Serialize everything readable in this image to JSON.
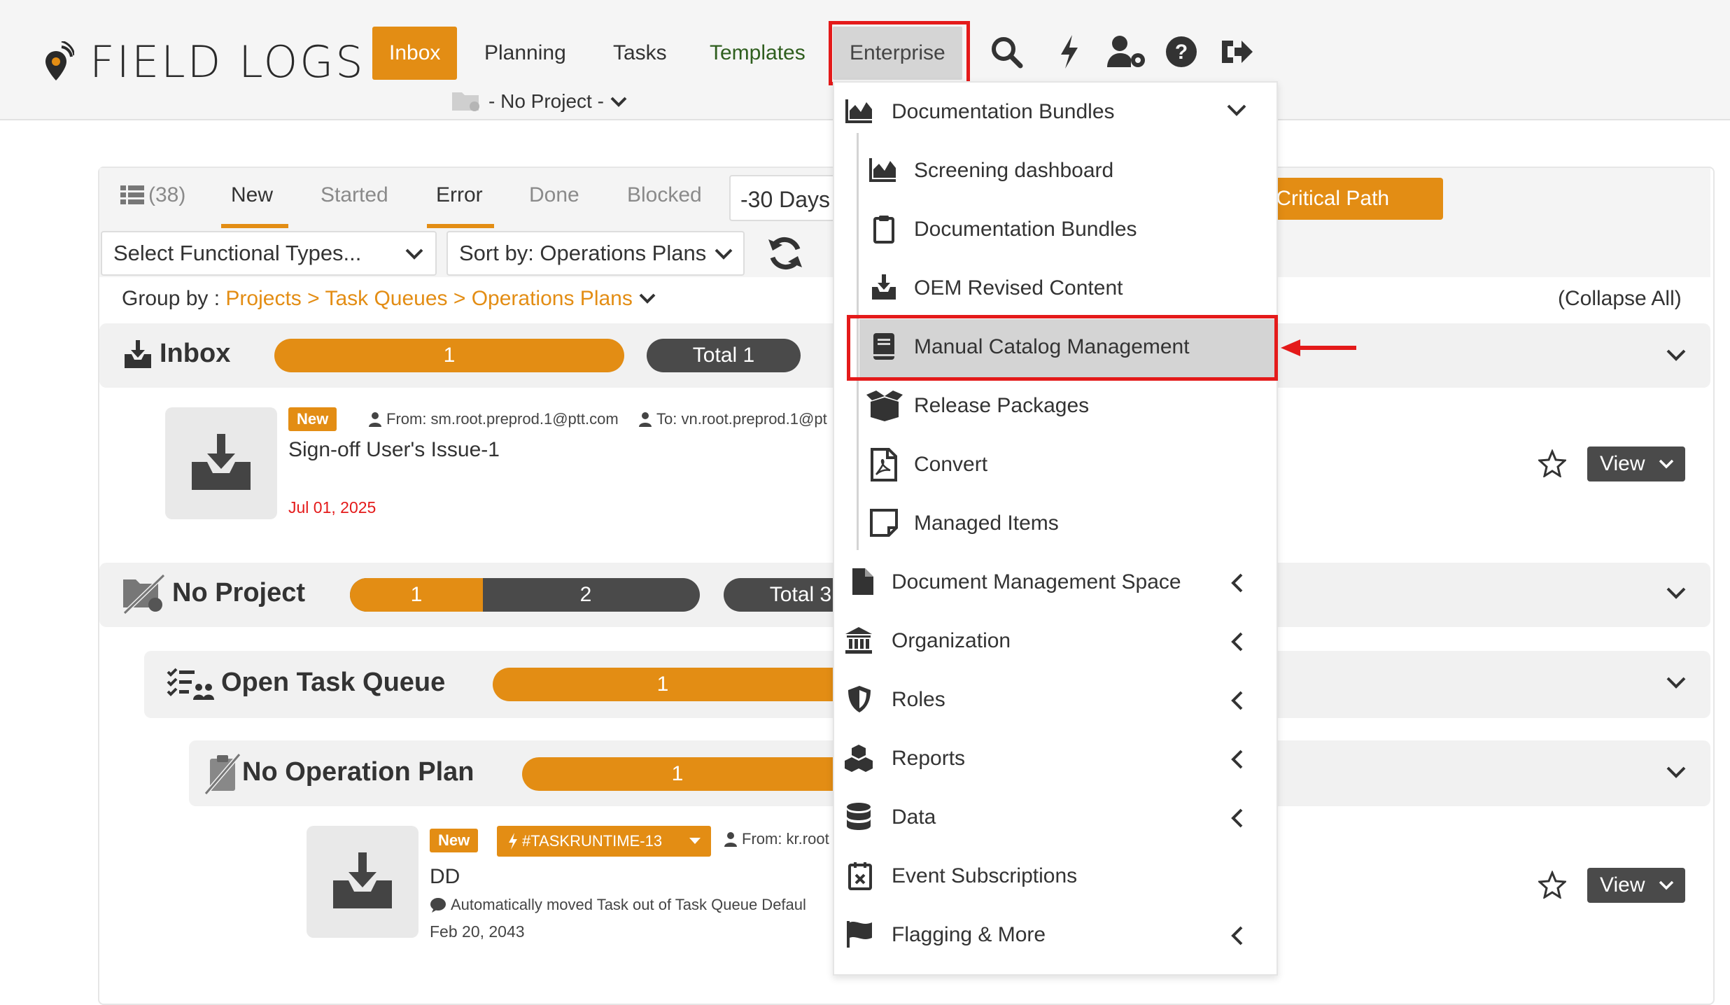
{
  "app": {
    "logo_text": "FIELD LOGS"
  },
  "nav": {
    "inbox": "Inbox",
    "planning": "Planning",
    "tasks": "Tasks",
    "templates": "Templates",
    "enterprise": "Enterprise",
    "icons": [
      "search-icon",
      "bolt-icon",
      "user-gear-icon",
      "help-icon",
      "logout-icon"
    ]
  },
  "project_selector": {
    "label": "- No Project -"
  },
  "tabs": {
    "count": "(38)",
    "new": "New",
    "started": "Started",
    "error": "Error",
    "done": "Done",
    "blocked": "Blocked",
    "days": "-30 Days",
    "critical_path": "Show Critical Path"
  },
  "filters": {
    "functional_types": "Select Functional Types...",
    "sort": "Sort by: Operations Plans"
  },
  "groupby": {
    "label": "Group by :",
    "path": "Projects > Task Queues > Operations Plans",
    "collapse_all": "(Collapse All)"
  },
  "sections": {
    "inbox": {
      "title": "Inbox",
      "bar_value": "1",
      "total": "Total 1"
    },
    "no_project": {
      "title": "No Project",
      "bar_a": "1",
      "bar_b": "2",
      "total": "Total 3"
    },
    "open_task_queue": {
      "title": "Open Task Queue",
      "bar_value": "1"
    },
    "no_operation_plan": {
      "title": "No Operation Plan",
      "bar_value": "1"
    }
  },
  "items": {
    "item1": {
      "badge": "New",
      "from": "From: sm.root.preprod.1@ptt.com",
      "to": "To: vn.root.preprod.1@pt",
      "title": "Sign-off User's Issue-1",
      "date": "Jul 01, 2025",
      "view": "View"
    },
    "item2": {
      "badge": "New",
      "task_tag": "#TASKRUNTIME-13",
      "from": "From: kr.root",
      "title": "DD",
      "message": "Automatically moved Task out of Task Queue Defaul",
      "date": "Feb 20, 2043",
      "view": "View"
    }
  },
  "menu": {
    "documentation_bundles_header": "Documentation Bundles",
    "sub": {
      "screening_dashboard": "Screening dashboard",
      "documentation_bundles": "Documentation Bundles",
      "oem_revised_content": "OEM Revised Content",
      "manual_catalog_management": "Manual Catalog Management",
      "release_packages": "Release Packages",
      "convert": "Convert",
      "managed_items": "Managed Items"
    },
    "document_management_space": "Document Management Space",
    "organization": "Organization",
    "roles": "Roles",
    "reports": "Reports",
    "data": "Data",
    "event_subscriptions": "Event Subscriptions",
    "flagging_more": "Flagging & More"
  },
  "colors": {
    "accent": "#e38d14",
    "dark": "#4a4a4a",
    "highlight": "#e41a1a"
  }
}
